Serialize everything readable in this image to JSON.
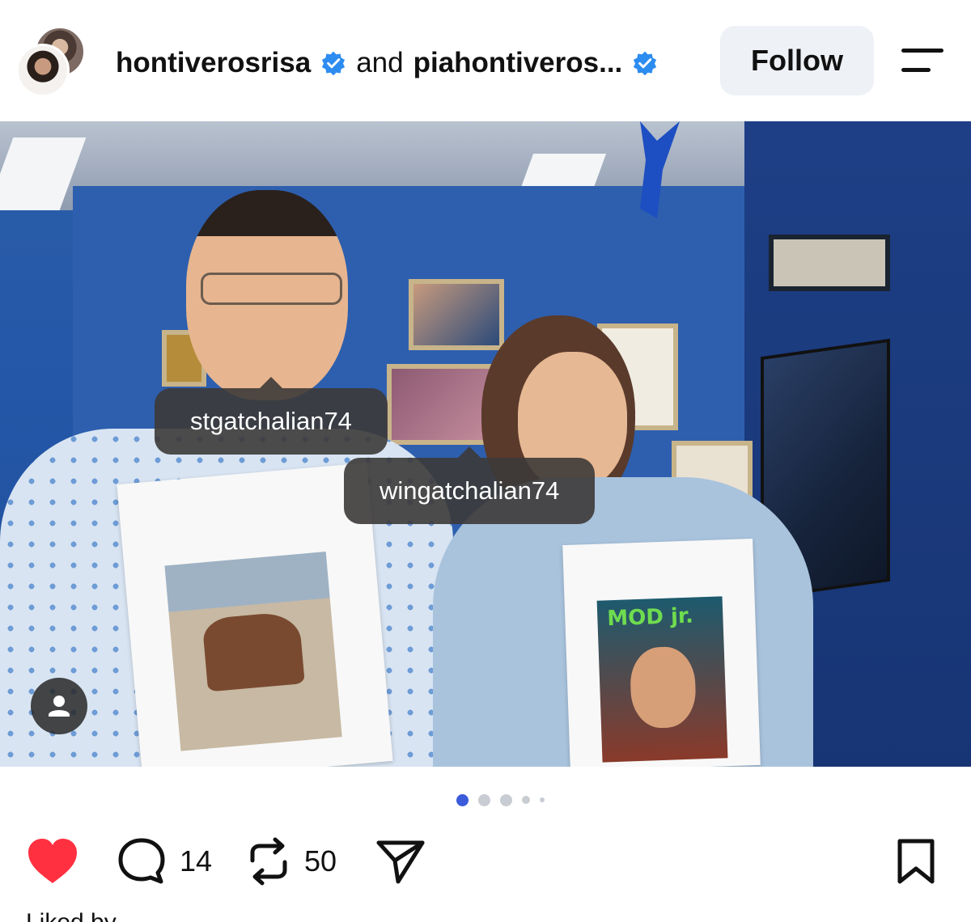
{
  "header": {
    "user1": "hontiverosrisa",
    "connector": "and",
    "user2": "piahontiveros...",
    "follow_label": "Follow"
  },
  "icons": {
    "verified": "verified-badge-icon",
    "menu": "menu-icon",
    "user": "user-icon",
    "like": "heart-icon",
    "comment": "comment-icon",
    "repost": "repost-icon",
    "share": "send-icon",
    "save": "bookmark-icon"
  },
  "colors": {
    "verified_blue": "#2d8cf0",
    "like_red": "#ff3040",
    "dot_active": "#3b5bdb",
    "follow_bg": "#eef1f5"
  },
  "photo": {
    "tags": [
      "stgatchalian74",
      "wingatchalian74"
    ],
    "magazine_text": "MOD jr."
  },
  "carousel": {
    "current": 1,
    "total": 5
  },
  "actions": {
    "comment_count": "14",
    "repost_count": "50"
  },
  "footer": {
    "liked_by": "Liked by"
  }
}
